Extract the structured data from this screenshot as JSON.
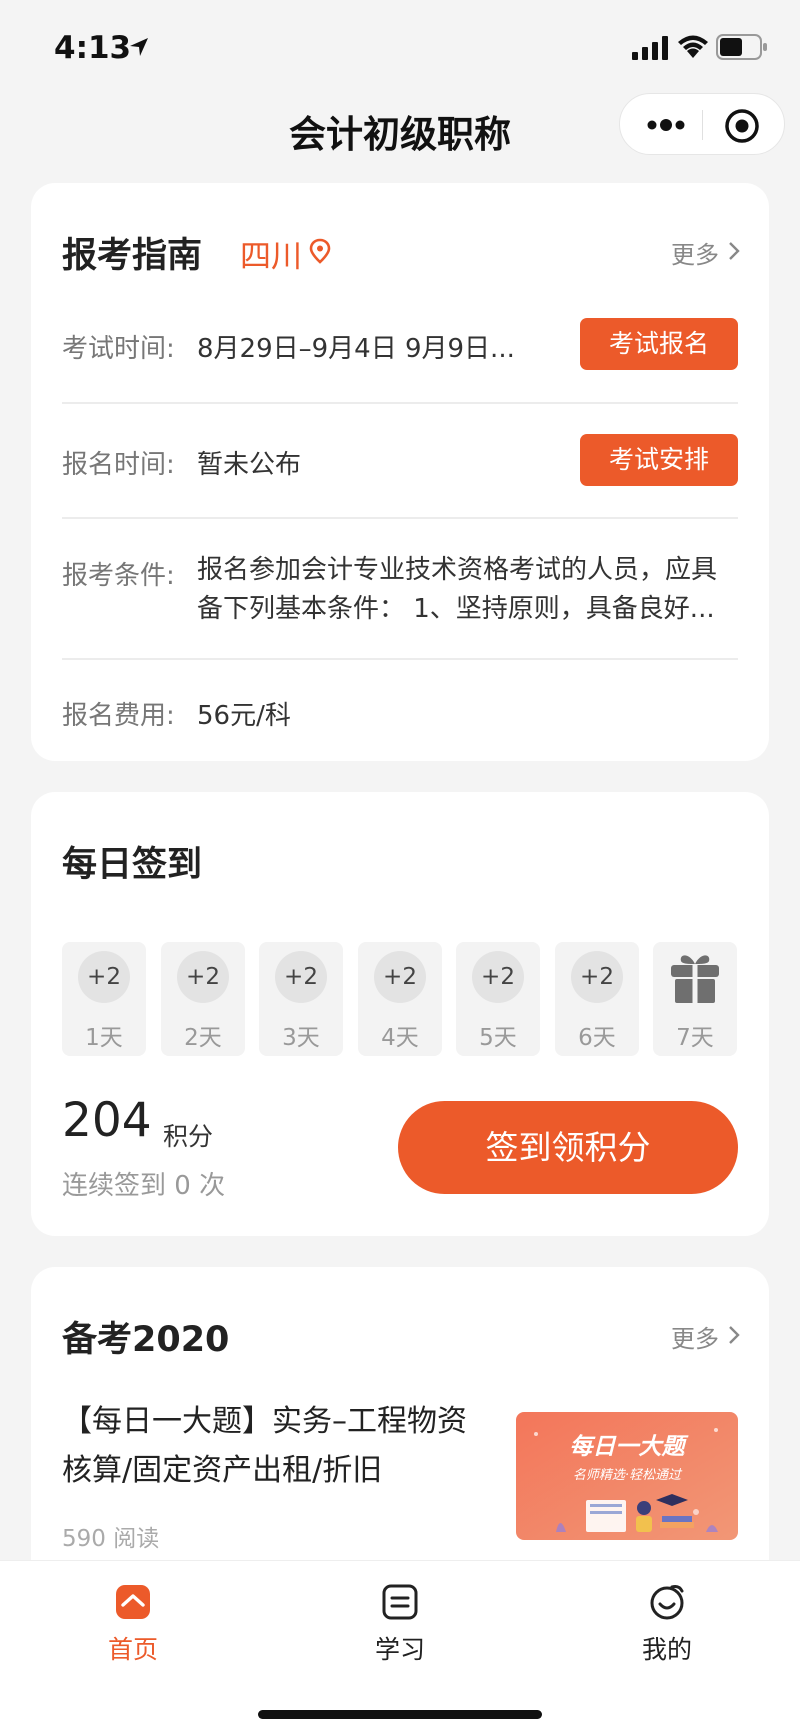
{
  "status_bar": {
    "time": "4:13"
  },
  "nav": {
    "title": "会计初级职称"
  },
  "guide": {
    "title": "报考指南",
    "province": "四川",
    "more_label": "更多",
    "rows": [
      {
        "label": "考试时间:",
        "value": "8月29日–9月4日 9月9日...",
        "button": "考试报名"
      },
      {
        "label": "报名时间:",
        "value": "暂未公布",
        "button": "考试安排"
      },
      {
        "label": "报考条件:",
        "value": "报名参加会计专业技术资格考试的人员，应具备下列基本条件： 1、坚持原则，具备良好..."
      },
      {
        "label": "报名费用:",
        "value": "56元/科"
      }
    ]
  },
  "checkin": {
    "title": "每日签到",
    "days": [
      {
        "points": "+2",
        "label": "1天"
      },
      {
        "points": "+2",
        "label": "2天"
      },
      {
        "points": "+2",
        "label": "3天"
      },
      {
        "points": "+2",
        "label": "4天"
      },
      {
        "points": "+2",
        "label": "5天"
      },
      {
        "points": "+2",
        "label": "6天"
      },
      {
        "icon": "gift-icon",
        "label": "7天"
      }
    ],
    "points": "204",
    "points_unit": "积分",
    "streak_text": "连续签到 0 次",
    "button": "签到领积分"
  },
  "prep": {
    "title": "备考2020",
    "more_label": "更多",
    "article": {
      "title": "【每日一大题】实务–工程物资核算/固定资产出租/折旧",
      "reads": "590 阅读",
      "thumb_title": "每日一大题",
      "thumb_subtitle": "名师精选·轻松通过"
    }
  },
  "tabs": [
    {
      "label": "首页",
      "icon": "home-icon",
      "active": true
    },
    {
      "label": "学习",
      "icon": "study-icon",
      "active": false
    },
    {
      "label": "我的",
      "icon": "profile-icon",
      "active": false
    }
  ],
  "colors": {
    "accent": "#ec5a2a",
    "background": "#f4f4f4"
  }
}
